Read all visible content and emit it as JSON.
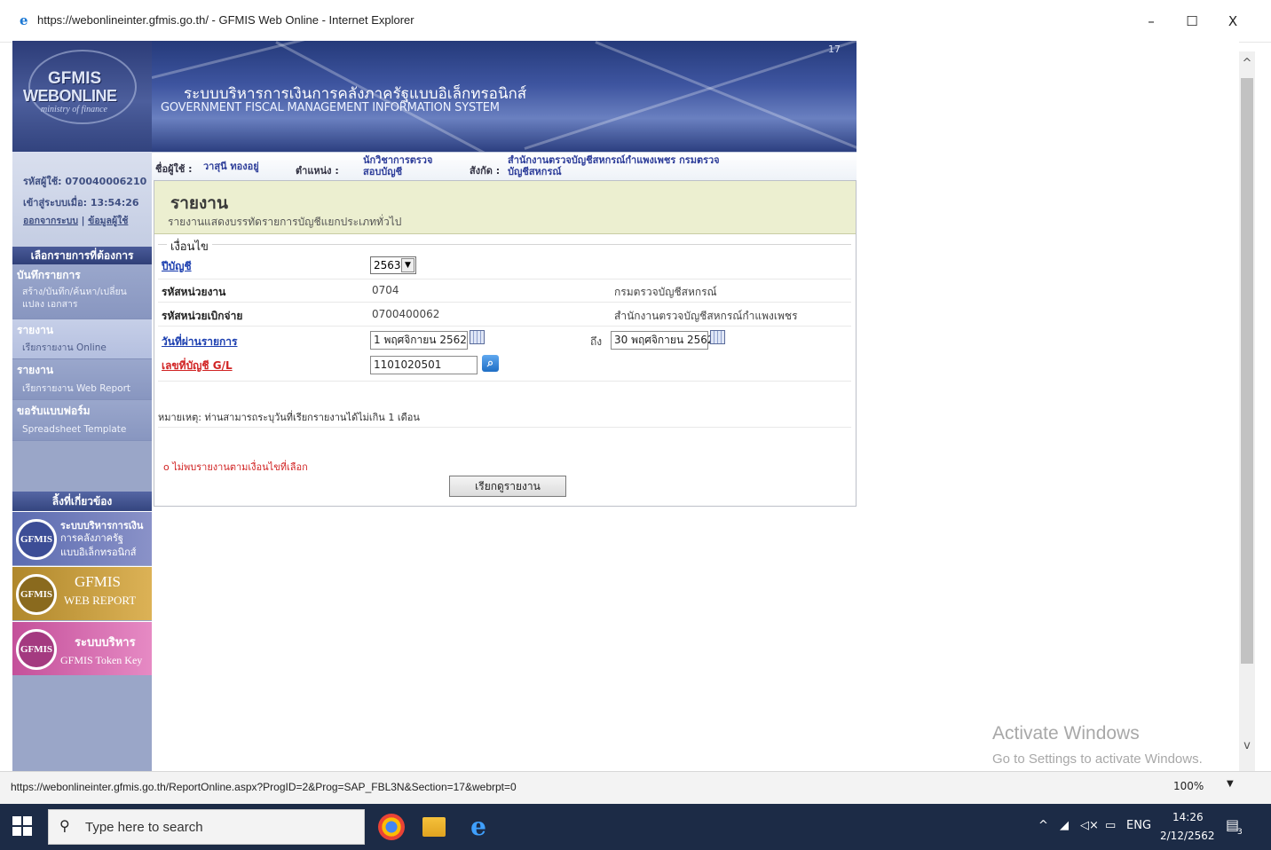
{
  "window": {
    "title": "https://webonlineinter.gfmis.go.th/ - GFMIS Web Online - Internet Explorer",
    "minimize": "–",
    "maximize": "☐",
    "close": "X"
  },
  "logo": {
    "line1": "GFMIS",
    "line2": "WEBONLINE",
    "line3": "ministry of finance"
  },
  "header": {
    "number": "17",
    "thai_title": "ระบบบริหารการเงินการคลังภาครัฐแบบอิเล็กทรอนิกส์",
    "english_title": "GOVERNMENT FISCAL MANAGEMENT INFORMATION SYSTEM"
  },
  "userinfo": {
    "user_code_label": "รหัสผู้ใช้:",
    "user_code": "070040006210",
    "login_label": "เข้าสู่ระบบเมื่อ:",
    "login_time": "13:54:26",
    "logout": "ออกจากระบบ",
    "sep": "|",
    "profile": "ข้อมูลผู้ใช้"
  },
  "userbar": {
    "name_label": "ชื่อผู้ใช้ :",
    "name": "วาสุนี ทองอยู่",
    "position_label": "ตำแหน่ง :",
    "position_1": "นักวิชาการตรวจ",
    "position_2": "สอบบัญชี",
    "affiliation_label": "สังกัด :",
    "affiliation_1": "สำนักงานตรวจบัญชีสหกรณ์กำแพงเพชร กรมตรวจ",
    "affiliation_2": "บัญชีสหกรณ์"
  },
  "menu": {
    "header": "เลือกรายการที่ต้องการ",
    "items": [
      {
        "title": "บันทึกรายการ",
        "sub1": "สร้าง/บันทึก/ค้นหา/เปลี่ยน",
        "sub2": "แปลง เอกสาร"
      },
      {
        "title": "รายงาน",
        "sub1": "เรียกรายงาน Online",
        "sub2": ""
      },
      {
        "title": "รายงาน",
        "sub1": "เรียกรายงาน Web Report",
        "sub2": ""
      },
      {
        "title": "ขอรับแบบฟอร์ม",
        "sub1": "Spreadsheet Template",
        "sub2": ""
      }
    ]
  },
  "links": {
    "header": "ลิ้งที่เกี่ยวข้อง",
    "banners": [
      {
        "badge": "GFMIS",
        "t1": "ระบบบริหารการเงิน",
        "t2": "การคลังภาครัฐ",
        "t3": "แบบอิเล็กทรอนิกส์"
      },
      {
        "badge": "GFMIS",
        "t1": "GFMIS",
        "t2": "WEB REPORT",
        "t3": ""
      },
      {
        "badge": "GFMIS",
        "t1": "ระบบบริหาร",
        "t2": "GFMIS Token Key",
        "t3": ""
      }
    ]
  },
  "report": {
    "title": "รายงาน",
    "subtitle": "รายงานแสดงบรรทัดรายการบัญชีแยกประเภททั่วไป",
    "legend": "เงื่อนไข",
    "fiscal_year_label": "ปีบัญชี",
    "fiscal_year": "2563",
    "unit_code_label": "รหัสหน่วยงาน",
    "unit_code": "0704",
    "unit_name": "กรมตรวจบัญชีสหกรณ์",
    "disb_code_label": "รหัสหน่วยเบิกจ่าย",
    "disb_code": "0700400062",
    "disb_name": "สำนักงานตรวจบัญชีสหกรณ์กำแพงเพชร",
    "post_date_label": "วันที่ผ่านรายการ",
    "date_from": "1 พฤศจิกายน 2562",
    "to_label": "ถึง",
    "date_to": "30 พฤศจิกายน 2562",
    "gl_label": "เลขที่บัญชี G/L",
    "gl_value": "1101020501",
    "note": "หมายเหตุ: ท่านสามารถระบุวันที่เรียกรายงานได้ไม่เกิน 1 เดือน",
    "warning": "o ไม่พบรายงานตามเงื่อนไขที่เลือก",
    "submit": "เรียกดูรายงาน"
  },
  "watermark": {
    "line1": "Activate Windows",
    "line2": "Go to Settings to activate Windows."
  },
  "statusbar": {
    "url": "https://webonlineinter.gfmis.go.th/ReportOnline.aspx?ProgID=2&Prog=SAP_FBL3N&Section=17&webrpt=0",
    "zoom": "100%"
  },
  "taskbar": {
    "search_placeholder": "Type here to search",
    "tray_lang": "ENG",
    "time": "14:26",
    "date": "2/12/2562",
    "notif_count": "3"
  }
}
